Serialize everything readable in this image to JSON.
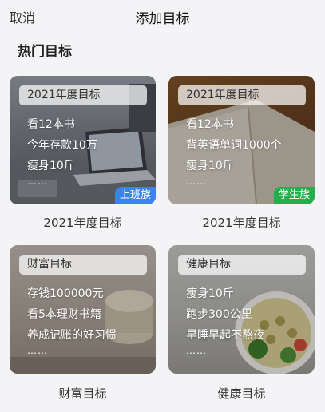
{
  "header": {
    "cancel_label": "取消",
    "title": "添加目标"
  },
  "section": {
    "title": "热门目标"
  },
  "cards": [
    {
      "head": "2021年度目标",
      "items": [
        "看12本书",
        "今年存款10万",
        "瘦身10斤"
      ],
      "dots": "……",
      "tag": "上班族",
      "tag_color": "#3b82f6",
      "caption": "2021年度目标"
    },
    {
      "head": "2021年度目标",
      "items": [
        "看12本书",
        "背英语单词1000个",
        "瘦身10斤"
      ],
      "dots": "……",
      "tag": "学生族",
      "tag_color": "#22b04a",
      "caption": "2021年度目标"
    },
    {
      "head": "财富目标",
      "items": [
        "存钱100000元",
        "看5本理财书籍",
        "养成记账的好习惯"
      ],
      "dots": "……",
      "caption": "财富目标"
    },
    {
      "head": "健康目标",
      "items": [
        "瘦身10斤",
        "跑步300公里",
        "早睡早起不熬夜"
      ],
      "dots": "……",
      "caption": "健康目标"
    }
  ]
}
